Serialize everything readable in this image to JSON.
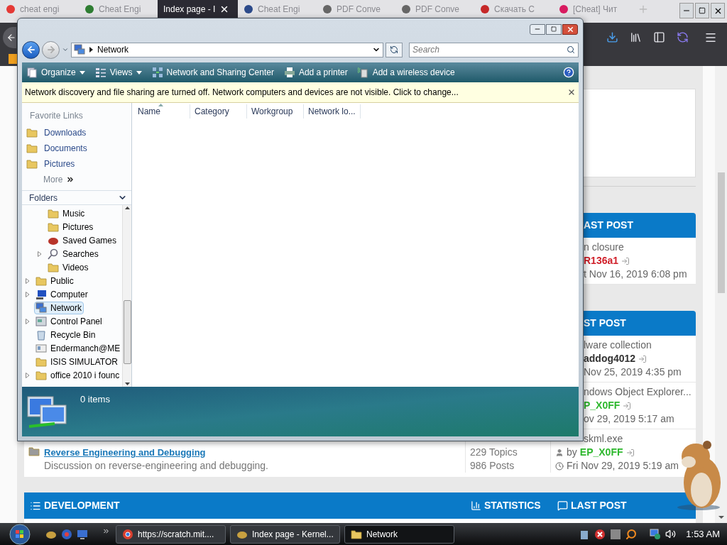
{
  "browser": {
    "tabs": [
      {
        "title": "cheat engi",
        "selected": false
      },
      {
        "title": "Cheat Engi",
        "selected": false
      },
      {
        "title": "Index page - I",
        "selected": true
      },
      {
        "title": "Cheat Engi",
        "selected": false
      },
      {
        "title": "PDF Conve",
        "selected": false
      },
      {
        "title": "PDF Conve",
        "selected": false
      },
      {
        "title": "Скачать С",
        "selected": false
      },
      {
        "title": "[Cheat] Чит",
        "selected": false
      }
    ],
    "forum": {
      "sections": [
        {
          "header": "AST POST",
          "rows": [
            {
              "topic": "n closure",
              "author": "R136a1",
              "color": "#d0202a",
              "date": "t Nov 16, 2019 6:08 pm"
            }
          ]
        },
        {
          "header": "ST POST",
          "rows": [
            {
              "topic": "lware collection",
              "author": "addog4012",
              "color": "#333333",
              "date": "Nov 25, 2019 4:35 pm"
            },
            {
              "topic": "ndows Object Explorer...",
              "author": "P_X0FF",
              "color": "#2eb82e",
              "date": "ov 29, 2019 5:17 am"
            }
          ]
        }
      ],
      "forum_row": {
        "title": "Reverse Engineering and Debugging",
        "description": "Discussion on reverse-engineering and debugging.",
        "topics": "229 Topics",
        "posts": "986 Posts",
        "last_topic": "skml.exe",
        "by": "by",
        "author": "EP_X0FF",
        "color": "#2eb82e",
        "date": "Fri Nov 29, 2019 5:19 am"
      },
      "category": {
        "title": "DEVELOPMENT",
        "statistics": "STATISTICS",
        "last_post": "LAST POST"
      }
    }
  },
  "explorer": {
    "address": "Network",
    "search_placeholder": "Search",
    "toolbar": [
      {
        "label": "Organize",
        "dropdown": true
      },
      {
        "label": "Views",
        "dropdown": true
      },
      {
        "label": "Network and Sharing Center",
        "dropdown": false
      },
      {
        "label": "Add a printer",
        "dropdown": false
      },
      {
        "label": "Add a wireless device",
        "dropdown": false
      }
    ],
    "infobar": "Network discovery and file sharing are turned off. Network computers and devices are not visible. Click to change...",
    "favorites": {
      "title": "Favorite Links",
      "items": [
        "Downloads",
        "Documents",
        "Pictures"
      ],
      "more": "More"
    },
    "folders": {
      "title": "Folders",
      "tree": [
        {
          "children": [
            {
              "label": "Music",
              "kind": "folder",
              "expandable": false,
              "selected": false
            },
            {
              "label": "Pictures",
              "kind": "folder",
              "expandable": false,
              "selected": false
            },
            {
              "label": "Saved Games",
              "kind": "games",
              "expandable": false,
              "selected": false
            },
            {
              "label": "Searches",
              "kind": "search",
              "expandable": true,
              "selected": false
            },
            {
              "label": "Videos",
              "kind": "folder",
              "expandable": false,
              "selected": false
            }
          ]
        },
        {
          "label": "Public",
          "kind": "folder",
          "expandable": true,
          "selected": false
        },
        {
          "label": "Computer",
          "kind": "computer",
          "expandable": true,
          "selected": false
        },
        {
          "label": "Network",
          "kind": "network",
          "expandable": false,
          "selected": true
        },
        {
          "label": "Control Panel",
          "kind": "control",
          "expandable": true,
          "selected": false
        },
        {
          "label": "Recycle Bin",
          "kind": "recycle",
          "expandable": false,
          "selected": false
        },
        {
          "label": "Endermanch@ME",
          "kind": "contact",
          "expandable": false,
          "selected": false
        },
        {
          "label": "ISIS SIMULATOR",
          "kind": "folder",
          "expandable": false,
          "selected": false
        },
        {
          "label": "office 2010 i founc",
          "kind": "folder",
          "expandable": true,
          "selected": false
        }
      ]
    },
    "columns": [
      {
        "label": "Name",
        "sorted": true
      },
      {
        "label": "Category",
        "sorted": false
      },
      {
        "label": "Workgroup",
        "sorted": false
      },
      {
        "label": "Network lo...",
        "sorted": false
      }
    ],
    "status": "0 items"
  },
  "taskbar": {
    "tasks": [
      {
        "label": "https://scratch.mit....",
        "selected": false
      },
      {
        "label": "Index page - Kernel...",
        "selected": false
      },
      {
        "label": "Network",
        "selected": true
      }
    ],
    "clock": "1:53 AM"
  }
}
